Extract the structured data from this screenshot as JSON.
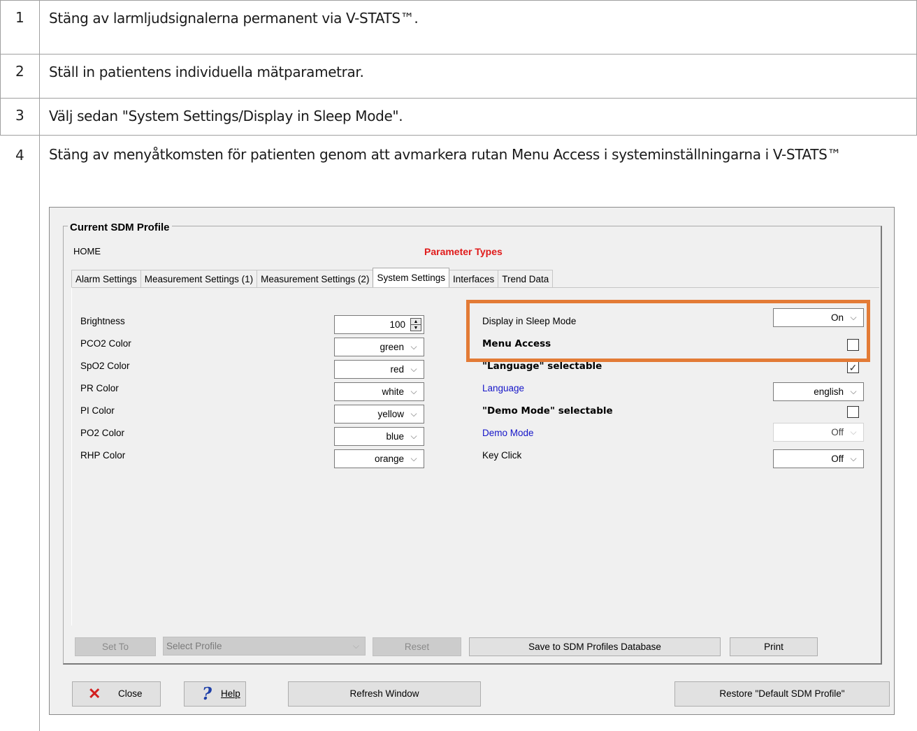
{
  "steps": [
    {
      "num": "1",
      "text": "Stäng av larmljudsignalerna permanent via V-STATS™."
    },
    {
      "num": "2",
      "text": "Ställ in patientens individuella mätparametrar."
    },
    {
      "num": "3",
      "text": "Välj sedan \"System Settings/Display in Sleep Mode\"."
    },
    {
      "num": "4",
      "text": "Stäng av menyåtkomsten för patienten genom att avmarkera rutan Menu Access i systeminställningarna i V-STATS™"
    }
  ],
  "dialog": {
    "group_title": "Current SDM Profile",
    "profile_name": "HOME",
    "parameter_types": "Parameter Types",
    "tabs": [
      {
        "label": "Alarm Settings",
        "active": false
      },
      {
        "label": "Measurement Settings (1)",
        "active": false
      },
      {
        "label": "Measurement Settings (2)",
        "active": false
      },
      {
        "label": "System Settings",
        "active": true
      },
      {
        "label": "Interfaces",
        "active": false
      },
      {
        "label": "Trend Data",
        "active": false
      }
    ],
    "left_settings": [
      {
        "label": "Brightness",
        "value": "100",
        "control": "spinner"
      },
      {
        "label": "PCO2 Color",
        "value": "green",
        "control": "dropdown"
      },
      {
        "label": "SpO2 Color",
        "value": "red",
        "control": "dropdown"
      },
      {
        "label": "PR Color",
        "value": "white",
        "control": "dropdown"
      },
      {
        "label": "PI Color",
        "value": "yellow",
        "control": "dropdown"
      },
      {
        "label": "PO2 Color",
        "value": "blue",
        "control": "dropdown"
      },
      {
        "label": "RHP Color",
        "value": "orange",
        "control": "dropdown"
      }
    ],
    "right_settings": {
      "display_sleep": {
        "label": "Display in Sleep Mode",
        "value": "On"
      },
      "menu_access": {
        "label": "Menu Access",
        "checked": false
      },
      "language_selectable": {
        "label": "\"Language\" selectable",
        "checked": true
      },
      "language": {
        "label": "Language",
        "value": "english"
      },
      "demo_selectable": {
        "label": "\"Demo Mode\" selectable",
        "checked": false
      },
      "demo_mode": {
        "label": "Demo Mode",
        "value": "Off",
        "enabled": false
      },
      "key_click": {
        "label": "Key Click",
        "value": "Off"
      }
    },
    "highlight_color": "#e37b36",
    "action_buttons": {
      "set_to": "Set To",
      "select_profile": "Select Profile",
      "reset": "Reset",
      "save": "Save to SDM Profiles Database",
      "print": "Print"
    },
    "bottom_buttons": {
      "close": "Close",
      "help": "Help",
      "refresh": "Refresh Window",
      "restore": "Restore \"Default SDM Profile\""
    }
  }
}
